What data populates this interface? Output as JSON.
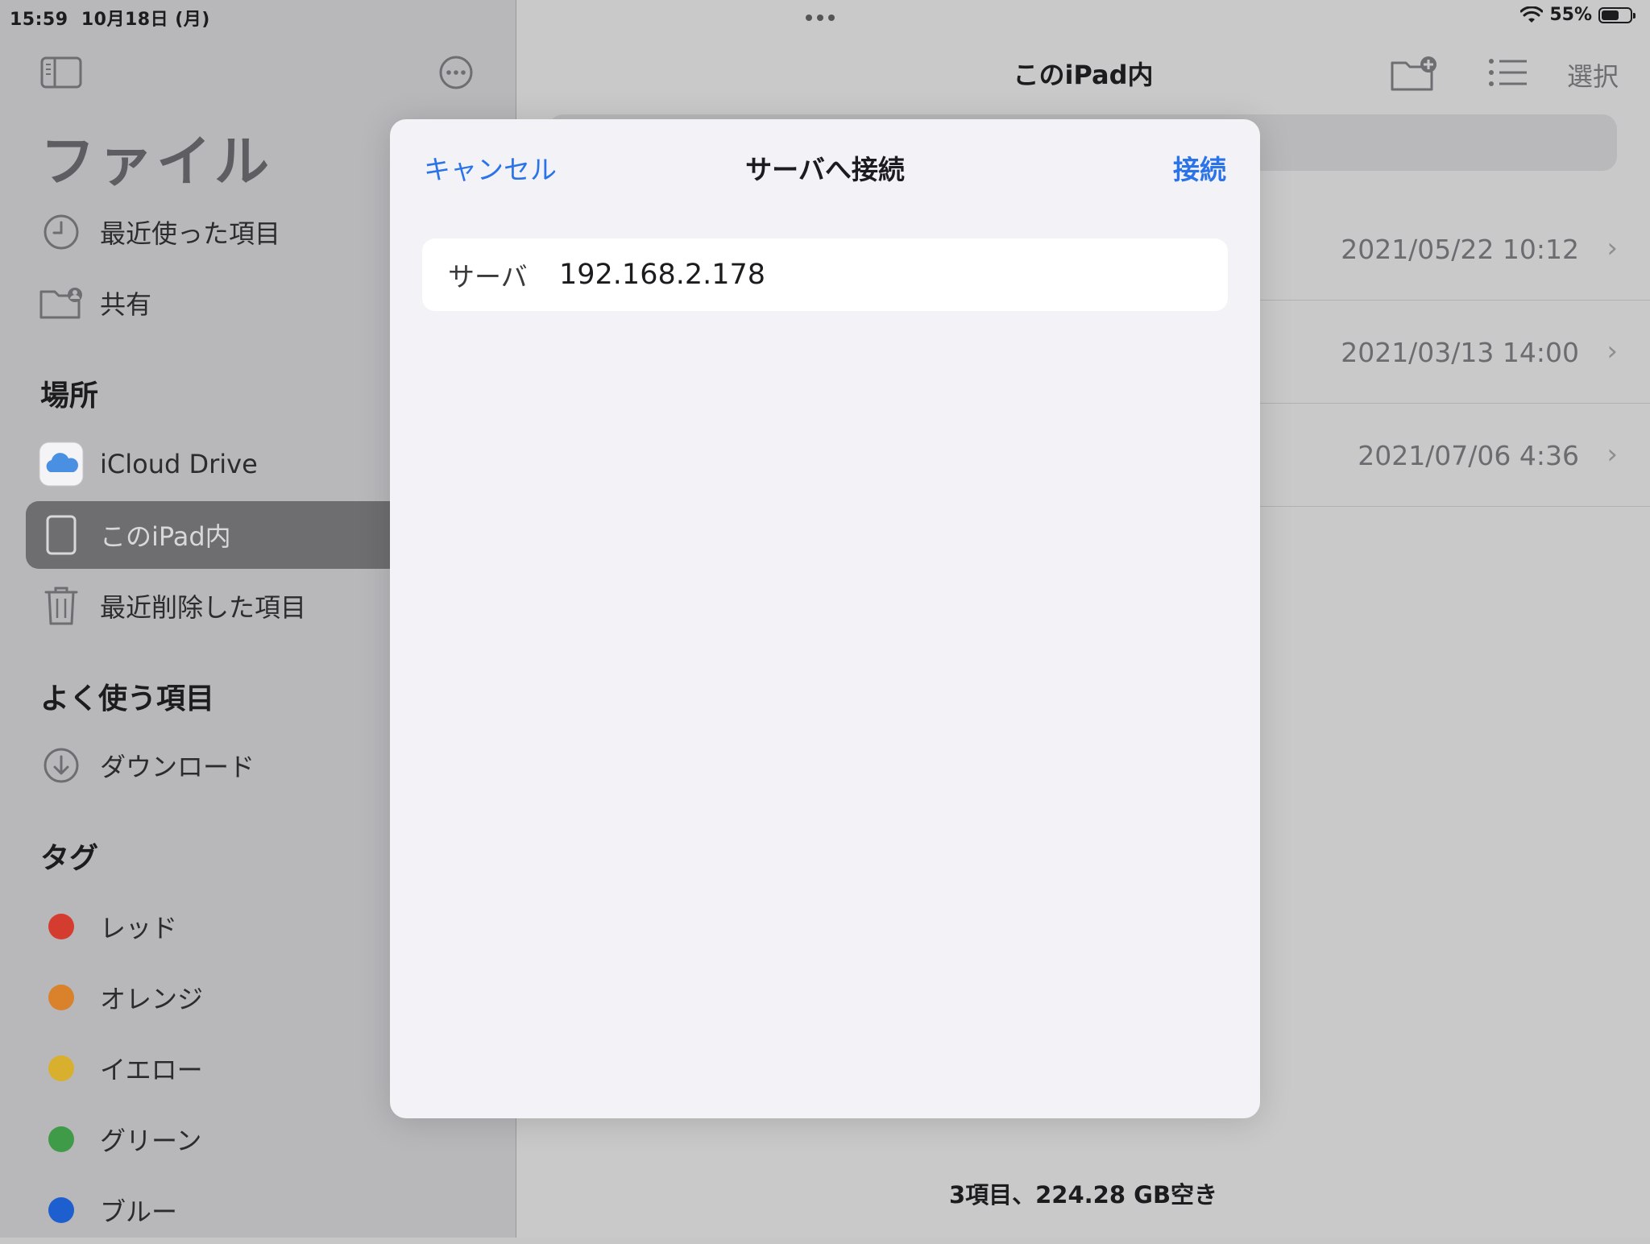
{
  "status_bar": {
    "time": "15:59",
    "date": "10月18日 (月)",
    "battery": "55%"
  },
  "sidebar": {
    "title": "ファイル",
    "top_items": [
      {
        "label": "最近使った項目",
        "icon": "clock-icon"
      },
      {
        "label": "共有",
        "icon": "shared-folder-icon"
      }
    ],
    "locations_header": "場所",
    "locations": [
      {
        "label": "iCloud Drive",
        "icon": "icloud-icon"
      },
      {
        "label": "このiPad内",
        "icon": "ipad-icon",
        "selected": true
      },
      {
        "label": "最近削除した項目",
        "icon": "trash-icon"
      }
    ],
    "favorites_header": "よく使う項目",
    "favorites": [
      {
        "label": "ダウンロード",
        "icon": "download-icon"
      }
    ],
    "tags_header": "タグ",
    "tags": [
      {
        "label": "レッド",
        "color": "#d43c30"
      },
      {
        "label": "オレンジ",
        "color": "#d9822b"
      },
      {
        "label": "イエロー",
        "color": "#d8b02d"
      },
      {
        "label": "グリーン",
        "color": "#3f9b48"
      },
      {
        "label": "ブルー",
        "color": "#1e5fd0"
      }
    ]
  },
  "main": {
    "title": "このiPad内",
    "select_label": "選択",
    "rows": [
      {
        "date": "2021/05/22 10:12"
      },
      {
        "date": "2021/03/13 14:00"
      },
      {
        "date": "2021/07/06 4:36"
      }
    ],
    "footer": "3項目、224.28 GB空き"
  },
  "modal": {
    "cancel_label": "キャンセル",
    "title": "サーバへ接続",
    "connect_label": "接続",
    "server_label": "サーバ",
    "server_value": "192.168.2.178"
  },
  "colors": {
    "accent": "#2a73e8",
    "modal_bg": "#f2f2f7"
  }
}
